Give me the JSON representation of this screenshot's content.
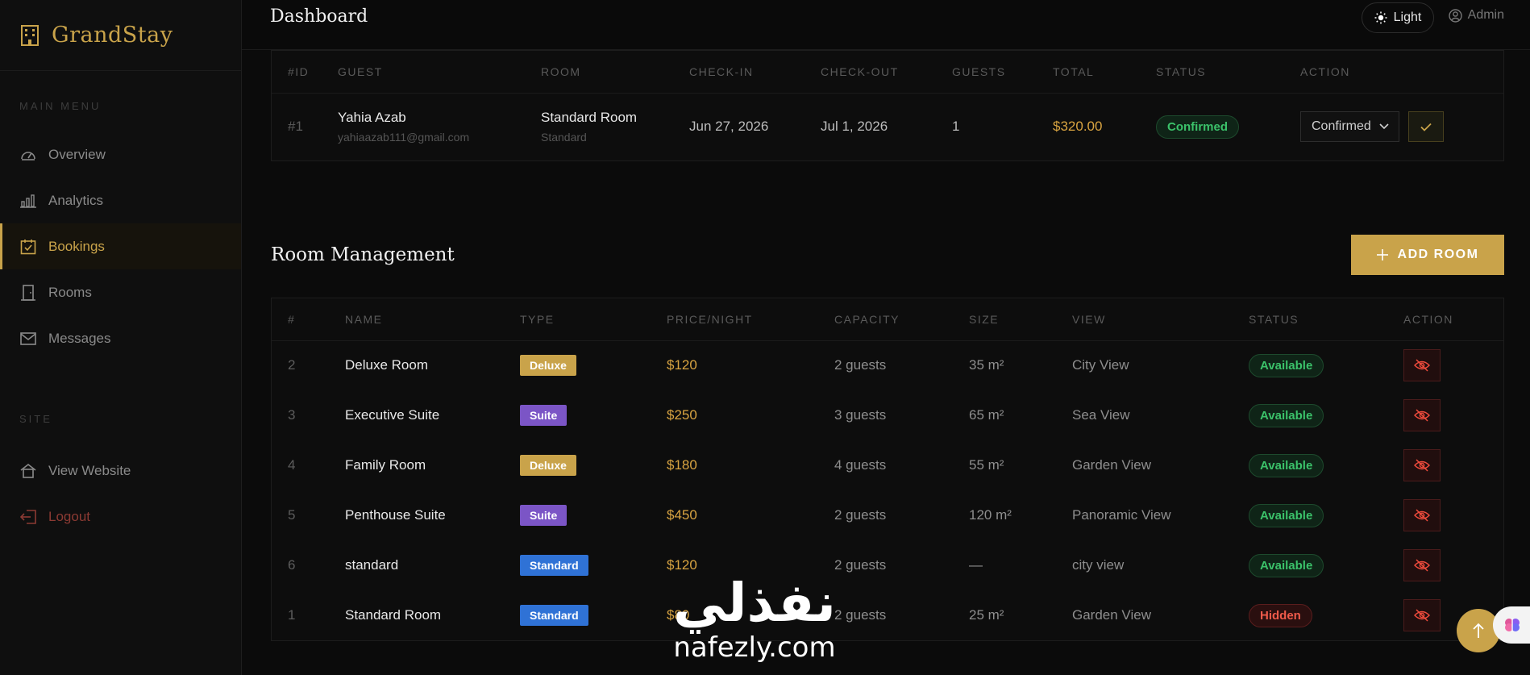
{
  "brand": {
    "name": "GrandStay"
  },
  "sidebar": {
    "main_menu_label": "MAIN MENU",
    "site_label": "SITE",
    "items": [
      {
        "label": "Overview",
        "icon": "speedometer-icon"
      },
      {
        "label": "Analytics",
        "icon": "bar-chart-icon"
      },
      {
        "label": "Bookings",
        "icon": "calendar-check-icon",
        "active": true
      },
      {
        "label": "Rooms",
        "icon": "door-icon"
      },
      {
        "label": "Messages",
        "icon": "envelope-icon"
      }
    ],
    "site_items": [
      {
        "label": "View Website",
        "icon": "house-icon"
      },
      {
        "label": "Logout",
        "icon": "logout-icon"
      }
    ]
  },
  "topbar": {
    "title": "Dashboard",
    "theme_label": "Light",
    "user_label": "Admin"
  },
  "bookings": {
    "headers": [
      "#ID",
      "GUEST",
      "ROOM",
      "CHECK-IN",
      "CHECK-OUT",
      "GUESTS",
      "TOTAL",
      "STATUS",
      "ACTION"
    ],
    "rows": [
      {
        "id": "#1",
        "guest_name": "Yahia Azab",
        "guest_email": "yahiaazab111@gmail.com",
        "room_name": "Standard Room",
        "room_type": "Standard",
        "check_in": "Jun 27, 2026",
        "check_out": "Jul 1, 2026",
        "guests": "1",
        "total": "$320.00",
        "status": "Confirmed",
        "action_value": "Confirmed"
      }
    ]
  },
  "rooms": {
    "title": "Room Management",
    "add_label": "ADD ROOM",
    "headers": [
      "#",
      "NAME",
      "TYPE",
      "PRICE/NIGHT",
      "CAPACITY",
      "SIZE",
      "VIEW",
      "STATUS",
      "ACTION"
    ],
    "rows": [
      {
        "num": "2",
        "name": "Deluxe Room",
        "type": "Deluxe",
        "price": "$120",
        "capacity": "2 guests",
        "size": "35 m²",
        "view": "City View",
        "status": "Available"
      },
      {
        "num": "3",
        "name": "Executive Suite",
        "type": "Suite",
        "price": "$250",
        "capacity": "3 guests",
        "size": "65 m²",
        "view": "Sea View",
        "status": "Available"
      },
      {
        "num": "4",
        "name": "Family Room",
        "type": "Deluxe",
        "price": "$180",
        "capacity": "4 guests",
        "size": "55 m²",
        "view": "Garden View",
        "status": "Available"
      },
      {
        "num": "5",
        "name": "Penthouse Suite",
        "type": "Suite",
        "price": "$450",
        "capacity": "2 guests",
        "size": "120 m²",
        "view": "Panoramic View",
        "status": "Available"
      },
      {
        "num": "6",
        "name": "standard",
        "type": "Standard",
        "price": "$120",
        "capacity": "2 guests",
        "size": "—",
        "view": "city view",
        "status": "Available"
      },
      {
        "num": "1",
        "name": "Standard Room",
        "type": "Standard",
        "price": "$80",
        "capacity": "2 guests",
        "size": "25 m²",
        "view": "Garden View",
        "status": "Hidden"
      }
    ]
  },
  "type_colors": {
    "Deluxe": "#c9a34a",
    "Suite": "#7b55c6",
    "Standard": "#2f72d6"
  },
  "watermark": {
    "arabic": "نفذلي",
    "latin": "nafezly.com"
  }
}
